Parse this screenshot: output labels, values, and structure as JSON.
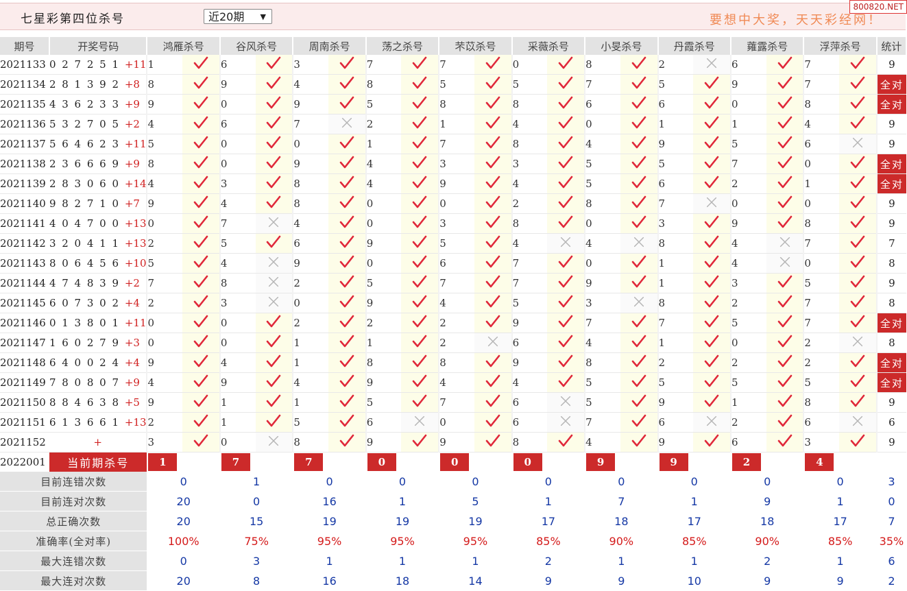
{
  "header": {
    "title": "七星彩第四位杀号",
    "period_select": "近20期",
    "slogan": "要想中大奖，天天彩经网！",
    "site_badge": "800820.NET"
  },
  "columns": {
    "period": "期号",
    "numbers": "开奖号码",
    "experts": [
      "鸿雁杀号",
      "谷风杀号",
      "周南杀号",
      "荡之杀号",
      "芣苡杀号",
      "采薇杀号",
      "小旻杀号",
      "丹霞杀号",
      "蕹露杀号",
      "浮萍杀号"
    ],
    "stats": "统计"
  },
  "rows": [
    {
      "period": "2021133",
      "digits": "0 2 7 2 5 1",
      "sum": "+11",
      "kills": [
        "1",
        "6",
        "3",
        "7",
        "7",
        "0",
        "8",
        "2",
        "6",
        "7"
      ],
      "hits": [
        1,
        1,
        1,
        1,
        1,
        1,
        1,
        0,
        1,
        1
      ],
      "stat": "9"
    },
    {
      "period": "2021134",
      "digits": "2 8 1 3 9 2",
      "sum": "+8",
      "kills": [
        "8",
        "9",
        "4",
        "8",
        "5",
        "5",
        "7",
        "5",
        "9",
        "7"
      ],
      "hits": [
        1,
        1,
        1,
        1,
        1,
        1,
        1,
        1,
        1,
        1
      ],
      "stat": "全对"
    },
    {
      "period": "2021135",
      "digits": "4 3 6 2 3 3",
      "sum": "+9",
      "kills": [
        "9",
        "0",
        "9",
        "5",
        "8",
        "8",
        "6",
        "6",
        "0",
        "8"
      ],
      "hits": [
        1,
        1,
        1,
        1,
        1,
        1,
        1,
        1,
        1,
        1
      ],
      "stat": "全对"
    },
    {
      "period": "2021136",
      "digits": "5 3 2 7 0 5",
      "sum": "+2",
      "kills": [
        "4",
        "6",
        "7",
        "2",
        "1",
        "4",
        "0",
        "1",
        "1",
        "4"
      ],
      "hits": [
        1,
        1,
        0,
        1,
        1,
        1,
        1,
        1,
        1,
        1
      ],
      "stat": "9"
    },
    {
      "period": "2021137",
      "digits": "5 6 4 6 2 3",
      "sum": "+11",
      "kills": [
        "5",
        "0",
        "0",
        "1",
        "7",
        "8",
        "4",
        "9",
        "5",
        "6"
      ],
      "hits": [
        1,
        1,
        1,
        1,
        1,
        1,
        1,
        1,
        1,
        0
      ],
      "stat": "9"
    },
    {
      "period": "2021138",
      "digits": "2 3 6 6 6 9",
      "sum": "+9",
      "kills": [
        "8",
        "0",
        "9",
        "4",
        "3",
        "3",
        "5",
        "5",
        "7",
        "0"
      ],
      "hits": [
        1,
        1,
        1,
        1,
        1,
        1,
        1,
        1,
        1,
        1
      ],
      "stat": "全对"
    },
    {
      "period": "2021139",
      "digits": "2 8 3 0 6 0",
      "sum": "+14",
      "kills": [
        "4",
        "3",
        "8",
        "4",
        "9",
        "4",
        "5",
        "6",
        "2",
        "1"
      ],
      "hits": [
        1,
        1,
        1,
        1,
        1,
        1,
        1,
        1,
        1,
        1
      ],
      "stat": "全对"
    },
    {
      "period": "2021140",
      "digits": "9 8 2 7 1 0",
      "sum": "+7",
      "kills": [
        "9",
        "4",
        "8",
        "0",
        "0",
        "2",
        "8",
        "7",
        "0",
        "0"
      ],
      "hits": [
        1,
        1,
        1,
        1,
        1,
        1,
        1,
        0,
        1,
        1
      ],
      "stat": "9"
    },
    {
      "period": "2021141",
      "digits": "4 0 4 7 0 0",
      "sum": "+13",
      "kills": [
        "0",
        "7",
        "4",
        "0",
        "3",
        "8",
        "0",
        "3",
        "9",
        "8"
      ],
      "hits": [
        1,
        0,
        1,
        1,
        1,
        1,
        1,
        1,
        1,
        1
      ],
      "stat": "9"
    },
    {
      "period": "2021142",
      "digits": "3 2 0 4 1 1",
      "sum": "+13",
      "kills": [
        "2",
        "5",
        "6",
        "9",
        "5",
        "4",
        "4",
        "8",
        "4",
        "7"
      ],
      "hits": [
        1,
        1,
        1,
        1,
        1,
        0,
        0,
        1,
        0,
        1
      ],
      "stat": "7"
    },
    {
      "period": "2021143",
      "digits": "8 0 6 4 5 6",
      "sum": "+10",
      "kills": [
        "5",
        "4",
        "9",
        "0",
        "6",
        "7",
        "0",
        "1",
        "4",
        "0"
      ],
      "hits": [
        1,
        0,
        1,
        1,
        1,
        1,
        1,
        1,
        0,
        1
      ],
      "stat": "8"
    },
    {
      "period": "2021144",
      "digits": "4 7 4 8 3 9",
      "sum": "+2",
      "kills": [
        "7",
        "8",
        "2",
        "5",
        "7",
        "7",
        "9",
        "1",
        "3",
        "5"
      ],
      "hits": [
        1,
        0,
        1,
        1,
        1,
        1,
        1,
        1,
        1,
        1
      ],
      "stat": "9"
    },
    {
      "period": "2021145",
      "digits": "6 0 7 3 0 2",
      "sum": "+4",
      "kills": [
        "2",
        "3",
        "0",
        "9",
        "4",
        "5",
        "3",
        "8",
        "2",
        "7"
      ],
      "hits": [
        1,
        0,
        1,
        1,
        1,
        1,
        0,
        1,
        1,
        1
      ],
      "stat": "8"
    },
    {
      "period": "2021146",
      "digits": "0 1 3 8 0 1",
      "sum": "+11",
      "kills": [
        "0",
        "0",
        "2",
        "2",
        "2",
        "9",
        "7",
        "7",
        "5",
        "7"
      ],
      "hits": [
        1,
        1,
        1,
        1,
        1,
        1,
        1,
        1,
        1,
        1
      ],
      "stat": "全对"
    },
    {
      "period": "2021147",
      "digits": "1 6 0 2 7 9",
      "sum": "+3",
      "kills": [
        "0",
        "0",
        "1",
        "1",
        "2",
        "6",
        "4",
        "1",
        "0",
        "2"
      ],
      "hits": [
        1,
        1,
        1,
        1,
        0,
        1,
        1,
        1,
        1,
        0
      ],
      "stat": "8"
    },
    {
      "period": "2021148",
      "digits": "6 4 0 0 2 4",
      "sum": "+4",
      "kills": [
        "9",
        "4",
        "1",
        "8",
        "8",
        "9",
        "8",
        "2",
        "2",
        "2"
      ],
      "hits": [
        1,
        1,
        1,
        1,
        1,
        1,
        1,
        1,
        1,
        1
      ],
      "stat": "全对"
    },
    {
      "period": "2021149",
      "digits": "7 8 0 8 0 7",
      "sum": "+9",
      "kills": [
        "4",
        "9",
        "4",
        "9",
        "4",
        "4",
        "5",
        "5",
        "5",
        "5"
      ],
      "hits": [
        1,
        1,
        1,
        1,
        1,
        1,
        1,
        1,
        1,
        1
      ],
      "stat": "全对"
    },
    {
      "period": "2021150",
      "digits": "8 8 4 6 3 8",
      "sum": "+5",
      "kills": [
        "9",
        "1",
        "1",
        "5",
        "7",
        "6",
        "5",
        "9",
        "1",
        "8"
      ],
      "hits": [
        1,
        1,
        1,
        1,
        1,
        0,
        1,
        1,
        1,
        1
      ],
      "stat": "9"
    },
    {
      "period": "2021151",
      "digits": "6 1 3 6 6 1",
      "sum": "+13",
      "kills": [
        "2",
        "1",
        "5",
        "6",
        "0",
        "6",
        "7",
        "6",
        "2",
        "6"
      ],
      "hits": [
        1,
        1,
        1,
        0,
        1,
        0,
        1,
        0,
        1,
        0
      ],
      "stat": "6"
    },
    {
      "period": "2021152",
      "digits": "",
      "sum": "+",
      "kills": [
        "3",
        "0",
        "8",
        "9",
        "9",
        "8",
        "4",
        "9",
        "6",
        "3"
      ],
      "hits": [
        1,
        0,
        1,
        1,
        1,
        1,
        1,
        1,
        1,
        1
      ],
      "stat": "9"
    }
  ],
  "current": {
    "period": "2022001",
    "label": "当前期杀号",
    "kills": [
      "1",
      "7",
      "7",
      "0",
      "0",
      "0",
      "9",
      "9",
      "2",
      "4"
    ]
  },
  "summary": [
    {
      "label": "目前连错次数",
      "values": [
        "0",
        "1",
        "0",
        "0",
        "0",
        "0",
        "0",
        "0",
        "0",
        "0"
      ],
      "stat": "3",
      "red": false
    },
    {
      "label": "目前连对次数",
      "values": [
        "20",
        "0",
        "16",
        "1",
        "5",
        "1",
        "7",
        "1",
        "9",
        "1"
      ],
      "stat": "0",
      "red": false
    },
    {
      "label": "总正确次数",
      "values": [
        "20",
        "15",
        "19",
        "19",
        "19",
        "17",
        "18",
        "17",
        "18",
        "17"
      ],
      "stat": "7",
      "red": false
    },
    {
      "label": "准确率(全对率)",
      "values": [
        "100%",
        "75%",
        "95%",
        "95%",
        "95%",
        "85%",
        "90%",
        "85%",
        "90%",
        "85%"
      ],
      "stat": "35%",
      "red": true
    },
    {
      "label": "最大连错次数",
      "values": [
        "0",
        "3",
        "1",
        "1",
        "1",
        "2",
        "1",
        "1",
        "2",
        "1"
      ],
      "stat": "6",
      "red": false
    },
    {
      "label": "最大连对次数",
      "values": [
        "20",
        "8",
        "16",
        "18",
        "14",
        "9",
        "9",
        "10",
        "9",
        "9"
      ],
      "stat": "2",
      "red": false
    }
  ],
  "icons": {
    "hit": "check-icon",
    "miss": "cross-icon"
  },
  "colors": {
    "accent_red": "#cc2a2a",
    "check_red": "#e0283a",
    "cross_gray": "#b5b5b5",
    "value_blue": "#1538a5",
    "header_gray": "#e3e3e3",
    "highlight_yellow": "#fdfde8"
  }
}
